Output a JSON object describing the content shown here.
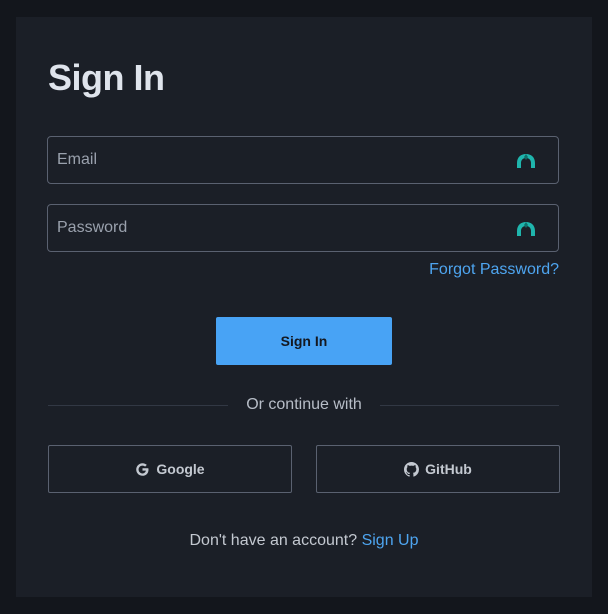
{
  "form": {
    "title": "Sign In",
    "email": {
      "value": "",
      "placeholder": "Email",
      "icon": "password-manager-icon"
    },
    "password": {
      "value": "",
      "placeholder": "Password",
      "icon": "password-manager-icon"
    },
    "forgot_label": "Forgot Password?",
    "submit_label": "Sign In"
  },
  "divider": {
    "label": "Or continue with"
  },
  "social": {
    "google_label": "Google",
    "github_label": "GitHub"
  },
  "footer": {
    "prompt": "Don't have an account?",
    "link_label": "Sign Up"
  },
  "colors": {
    "page_background": "#13161c",
    "card_background": "#1b1f27",
    "accent": "#48a3f5",
    "link": "#4ea5f0",
    "field_icon": "#1fb5ad"
  }
}
